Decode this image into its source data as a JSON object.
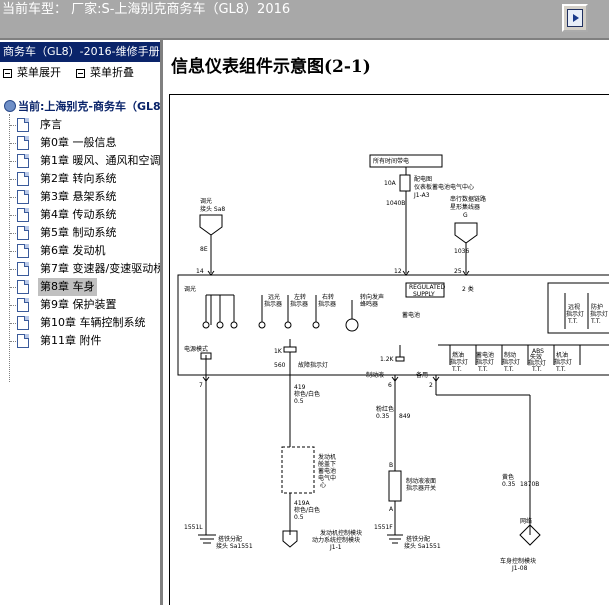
{
  "titlebar": {
    "title": "当前车型： 厂家:S-上海别克商务车（GL8）2016"
  },
  "sidebar": {
    "book_title": "商务车（GL8）-2016-维修手册",
    "expand_label": "菜单展开",
    "collapse_label": "菜单折叠",
    "root_label": "当前:上海别克-商务车（GL8）",
    "items": [
      {
        "label": "序言"
      },
      {
        "label": "第0章 一般信息"
      },
      {
        "label": "第1章 暖风、通风和空调"
      },
      {
        "label": "第2章 转向系统"
      },
      {
        "label": "第3章 悬架系统"
      },
      {
        "label": "第4章 传动系统"
      },
      {
        "label": "第5章 制动系统"
      },
      {
        "label": "第6章 发动机"
      },
      {
        "label": "第7章 变速器/变速驱动桥"
      },
      {
        "label": "第8章 车身"
      },
      {
        "label": "第9章 保护装置"
      },
      {
        "label": "第10章 车辆控制系统"
      },
      {
        "label": "第11章 附件"
      }
    ],
    "selected_index": 9
  },
  "main": {
    "page_title": "信息仪表组件示意图(2-1)"
  },
  "diagram": {
    "hot_label": "所有时间带电",
    "fuse": "10A",
    "fuse_box_1": "配电图",
    "fuse_box_2": "仪表板蓄电池电气中心",
    "fuse_box_3": "J1-A3",
    "wire_1040": "1040B",
    "dimmer_1": "调光",
    "dimmer_2": "接头 Sa8",
    "dimmer_wire": "8E",
    "serial_1": "串行数据链路",
    "serial_2": "星形集线器",
    "serial_3": "G",
    "serial_wire": "1036",
    "pin_14": "14",
    "pin_12": "12",
    "pin_25": "25",
    "cluster_dim": "调光",
    "regulated_1": "REGULATED",
    "regulated_2": "SUPPLY",
    "class2": "2 类",
    "battery": "蓄电池",
    "low_beam_1": "远光",
    "low_beam_2": "指示器",
    "left_turn_1": "左转",
    "left_turn_2": "指示器",
    "right_turn_1": "右转",
    "right_turn_2": "指示器",
    "chime_1": "转向发声",
    "chime_2": "蜂鸣器",
    "far_1": "远视",
    "far_2": "指示灯",
    "far_3": "T.T.",
    "guard_1": "防护",
    "guard_2": "指示灯",
    "guard_3": "T.T.",
    "power_mode": "电源模式",
    "fuel_1": "燃油",
    "fuel_2": "指示灯",
    "fuel_3": "T.T.",
    "batt_1": "蓄电池",
    "batt_2": "指示灯",
    "batt_3": "T.T.",
    "brake_1": "制动",
    "brake_2": "指示灯",
    "brake_3": "T.T.",
    "abs_1": "ABS",
    "abs_2": "失效",
    "abs_3": "指示灯",
    "abs_4": "T.T.",
    "oil_1": "机油",
    "oil_2": "指示灯",
    "oil_3": "T.T.",
    "res_1k": "1K",
    "res_1_2k": "1.2K",
    "wire_560": "560",
    "fault_label": "故障指示灯",
    "brake_fluid_label": "制动液",
    "spare": "备用",
    "pin_7": "7",
    "pin_6": "6",
    "pin_2": "2",
    "wire_419_1": "419",
    "wire_419_2": "棕色/白色",
    "wire_419_3": "0.5",
    "engine_box_1": "发动机",
    "engine_box_2": "舱盖下",
    "engine_box_3": "蓄电池",
    "engine_box_4": "电气中",
    "engine_box_5": "心",
    "wire_419a_1": "419A",
    "wire_419a_2": "棕色/白色",
    "wire_419a_3": "0.5",
    "wire_pink_1": "粉红色",
    "wire_pink_2": "0.35",
    "wire_pink_3": "849",
    "pin_b": "B",
    "pin_a": "A",
    "switch_1": "制动液液面",
    "switch_2": "指示器开关",
    "wire_yellow_1": "黄色",
    "wire_yellow_2": "0.35",
    "wire_yellow_3": "1870B",
    "network": "网络",
    "ground_1551l": "1551L",
    "ground_1551f": "1551F",
    "ground_left_1": "搭铁分配",
    "ground_left_2": "接头 Sa1551",
    "ecm_1": "发动机控制模块",
    "ecm_2": "动力系统控制模块",
    "ecm_3": "J1-1",
    "ground_mid_1": "搭铁分配",
    "ground_mid_2": "接头 Sa1551",
    "bcm_1": "车身控制模块",
    "bcm_2": "J1-08"
  }
}
